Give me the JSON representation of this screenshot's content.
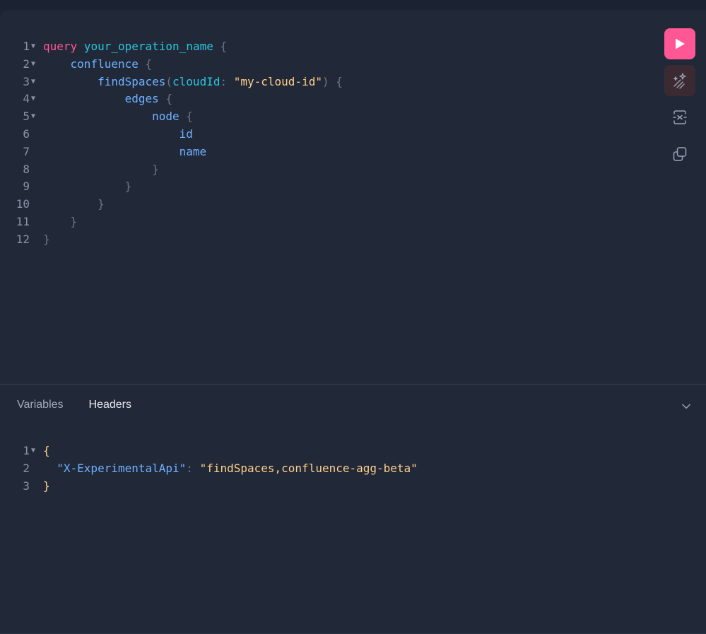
{
  "query_lines": [
    {
      "n": "1",
      "fold": true,
      "tokens": [
        {
          "t": "query",
          "c": "kw"
        },
        {
          "t": " ",
          "c": ""
        },
        {
          "t": "your_operation_name",
          "c": "op"
        },
        {
          "t": " {",
          "c": "pun"
        }
      ]
    },
    {
      "n": "2",
      "fold": true,
      "tokens": [
        {
          "t": "    ",
          "c": ""
        },
        {
          "t": "confluence",
          "c": "fld"
        },
        {
          "t": " {",
          "c": "pun"
        }
      ]
    },
    {
      "n": "3",
      "fold": true,
      "tokens": [
        {
          "t": "        ",
          "c": ""
        },
        {
          "t": "findSpaces",
          "c": "fld"
        },
        {
          "t": "(",
          "c": "pun"
        },
        {
          "t": "cloudId",
          "c": "arg"
        },
        {
          "t": ": ",
          "c": "pun"
        },
        {
          "t": "\"my-cloud-id\"",
          "c": "str"
        },
        {
          "t": ") {",
          "c": "pun"
        }
      ]
    },
    {
      "n": "4",
      "fold": true,
      "tokens": [
        {
          "t": "            ",
          "c": ""
        },
        {
          "t": "edges",
          "c": "fld"
        },
        {
          "t": " {",
          "c": "pun"
        }
      ]
    },
    {
      "n": "5",
      "fold": true,
      "tokens": [
        {
          "t": "                ",
          "c": ""
        },
        {
          "t": "node",
          "c": "fld"
        },
        {
          "t": " {",
          "c": "pun"
        }
      ]
    },
    {
      "n": "6",
      "fold": false,
      "tokens": [
        {
          "t": "                    ",
          "c": ""
        },
        {
          "t": "id",
          "c": "fld"
        }
      ]
    },
    {
      "n": "7",
      "fold": false,
      "tokens": [
        {
          "t": "                    ",
          "c": ""
        },
        {
          "t": "name",
          "c": "fld"
        }
      ]
    },
    {
      "n": "8",
      "fold": false,
      "tokens": [
        {
          "t": "                ",
          "c": ""
        },
        {
          "t": "}",
          "c": "pun"
        }
      ]
    },
    {
      "n": "9",
      "fold": false,
      "tokens": [
        {
          "t": "            ",
          "c": ""
        },
        {
          "t": "}",
          "c": "pun"
        }
      ]
    },
    {
      "n": "10",
      "fold": false,
      "tokens": [
        {
          "t": "        ",
          "c": ""
        },
        {
          "t": "}",
          "c": "pun"
        }
      ]
    },
    {
      "n": "11",
      "fold": false,
      "tokens": [
        {
          "t": "    ",
          "c": ""
        },
        {
          "t": "}",
          "c": "pun"
        }
      ]
    },
    {
      "n": "12",
      "fold": false,
      "tokens": [
        {
          "t": "}",
          "c": "pun"
        }
      ]
    }
  ],
  "tabs": [
    {
      "label": "Variables",
      "active": false
    },
    {
      "label": "Headers",
      "active": true
    }
  ],
  "header_lines": [
    {
      "n": "1",
      "fold": true,
      "tokens": [
        {
          "t": "{",
          "c": "brace"
        }
      ]
    },
    {
      "n": "2",
      "fold": false,
      "tokens": [
        {
          "t": "  ",
          "c": ""
        },
        {
          "t": "\"X-ExperimentalApi\"",
          "c": "key"
        },
        {
          "t": ": ",
          "c": "pun"
        },
        {
          "t": "\"findSpaces,confluence-agg-beta\"",
          "c": "str"
        }
      ]
    },
    {
      "n": "3",
      "fold": false,
      "tokens": [
        {
          "t": "}",
          "c": "brace"
        }
      ]
    }
  ],
  "toolbar": {
    "run_icon": "play-icon",
    "prettify_icon": "magic-wand-icon",
    "merge_icon": "merge-fragments-icon",
    "copy_icon": "copy-icon"
  },
  "colors": {
    "accent": "#ff5794",
    "background": "#212939"
  }
}
